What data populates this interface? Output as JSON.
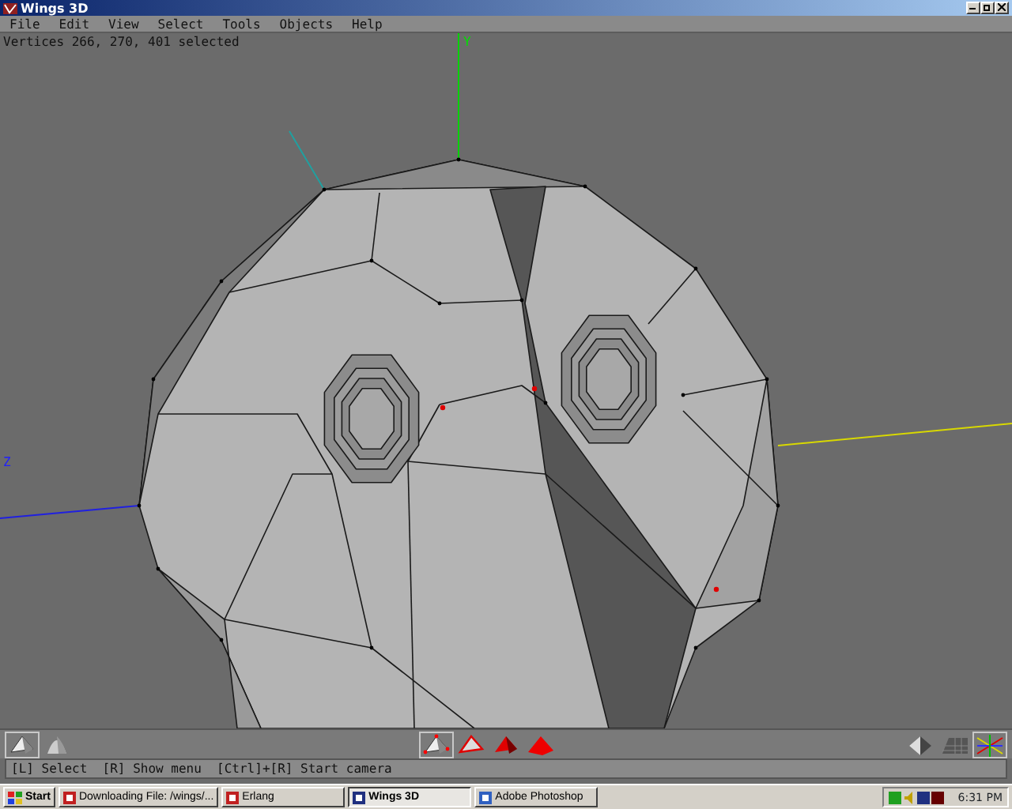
{
  "window": {
    "title": "Wings 3D"
  },
  "menu": [
    "File",
    "Edit",
    "View",
    "Select",
    "Tools",
    "Objects",
    "Help"
  ],
  "viewport": {
    "info": "Vertices 266, 270, 401 selected",
    "axes": [
      {
        "kind": "y",
        "label": "Y"
      },
      {
        "kind": "z",
        "label": "Z"
      }
    ]
  },
  "toolbar": {
    "shading": [
      {
        "kind": "flat",
        "selected": true
      },
      {
        "kind": "smooth",
        "selected": false
      }
    ],
    "modes": [
      {
        "kind": "vertex",
        "selected": true
      },
      {
        "kind": "edge",
        "selected": false
      },
      {
        "kind": "face",
        "selected": false
      },
      {
        "kind": "body",
        "selected": false
      }
    ],
    "view": [
      {
        "kind": "perspective",
        "selected": false
      },
      {
        "kind": "groundplane",
        "selected": false
      },
      {
        "kind": "axes",
        "selected": true
      }
    ]
  },
  "status_bar": "[L] Select  [R] Show menu  [Ctrl]+[R] Start camera",
  "taskbar": {
    "start": "Start",
    "tasks": [
      {
        "label": "Downloading File: /wings/...",
        "selected": false
      },
      {
        "label": "Erlang",
        "selected": false
      },
      {
        "label": "Wings 3D",
        "selected": true
      },
      {
        "label": "Adobe Photoshop",
        "selected": false
      }
    ],
    "clock": "6:31 PM"
  }
}
